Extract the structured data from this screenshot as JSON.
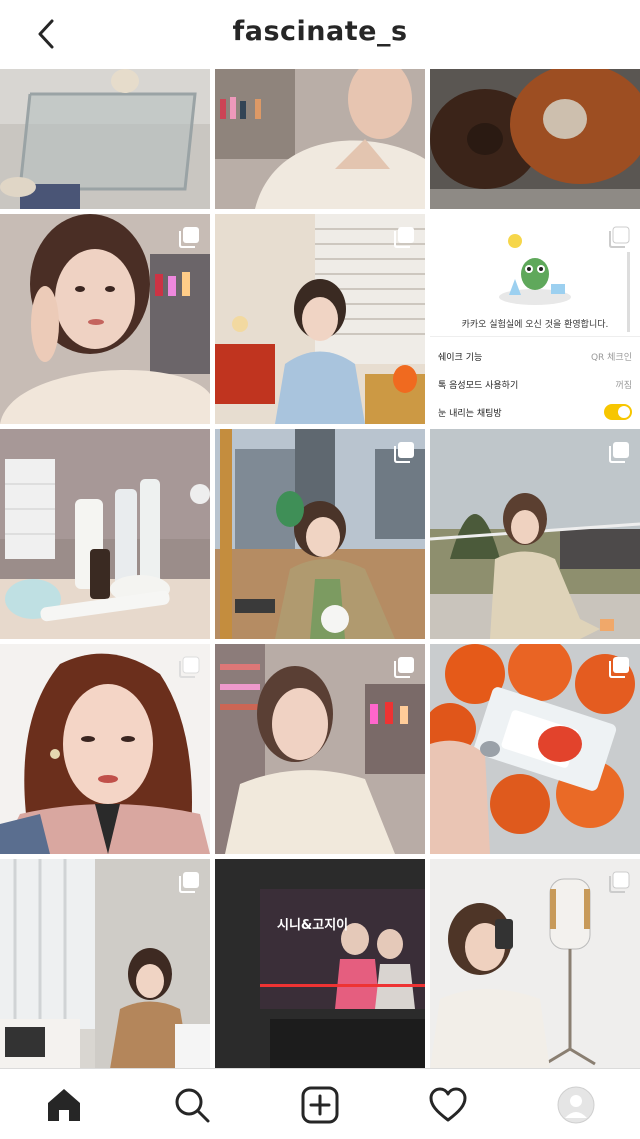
{
  "header": {
    "username": "fascinate_s",
    "back_icon": "chevron-left-icon"
  },
  "screenshot_post": {
    "welcome": "카카오 실험실에 오신 것을 환영합니다.",
    "rows": [
      {
        "label": "쉐이크 기능",
        "value": "QR 체크인"
      },
      {
        "label": "톡 음성모드 사용하기",
        "value": "꺼짐"
      },
      {
        "label": "눈 내리는 채팅방",
        "value": ""
      }
    ],
    "accent": "#f7c600"
  },
  "tv_post": {
    "screen_title": "시니&고지이"
  },
  "bottom_nav": [
    "home-icon",
    "search-icon",
    "new-post-icon",
    "activity-heart-icon",
    "profile-avatar-icon"
  ],
  "colors": {
    "text": "#262626",
    "divider": "#dbdbdb"
  }
}
